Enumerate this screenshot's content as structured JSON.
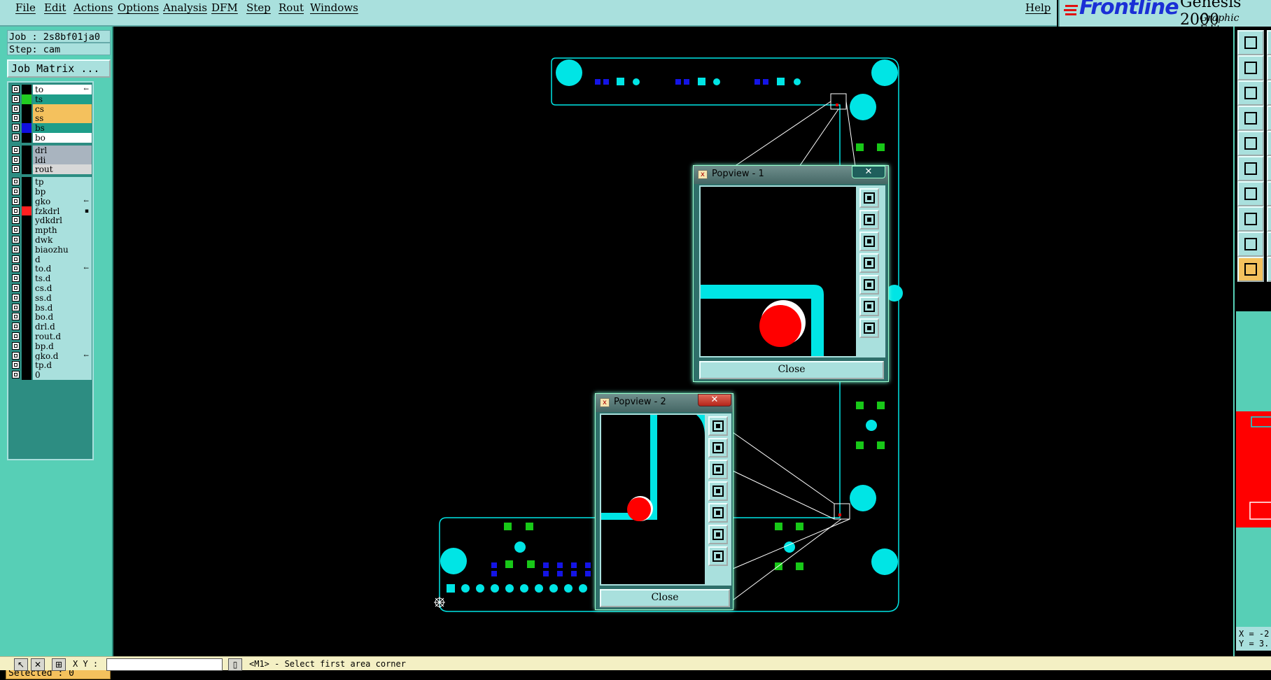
{
  "menu": {
    "items": [
      "File",
      "Edit",
      "Actions",
      "Options",
      "Analysis",
      "DFM",
      "Step",
      "Rout",
      "Windows"
    ],
    "help": "Help"
  },
  "brand": {
    "logo": "Frontline",
    "product": "Genesis 2000",
    "subtitle": "Graphic Editor"
  },
  "job": {
    "job_line": "Job : 2s8bf01ja0",
    "step_line": "Step: cam",
    "matrix_button": "Job Matrix ..."
  },
  "layers": [
    {
      "name": "to",
      "color": "#ffffff",
      "swatch": "#000000",
      "mark": "←"
    },
    {
      "name": "ts",
      "color": "#1f9e8a",
      "swatch": "#22cc22",
      "mark": ""
    },
    {
      "name": "cs",
      "color": "#f4c15d",
      "swatch": "#000000",
      "mark": ""
    },
    {
      "name": "ss",
      "color": "#f4c15d",
      "swatch": "#000000",
      "mark": ""
    },
    {
      "name": "bs",
      "color": "#1f9e8a",
      "swatch": "#1010e0",
      "mark": ""
    },
    {
      "name": "bo",
      "color": "#ffffff",
      "swatch": "#000000",
      "mark": ""
    },
    {
      "name": "drl",
      "color": "#a9b4bf",
      "swatch": "#000000",
      "mark": ""
    },
    {
      "name": "ldi",
      "color": "#a9b4bf",
      "swatch": "#000000",
      "mark": ""
    },
    {
      "name": "rout",
      "color": "#d8d8d8",
      "swatch": "#000000",
      "mark": ""
    },
    {
      "name": "tp",
      "color": "#a9e0dd",
      "swatch": "#000000",
      "mark": ""
    },
    {
      "name": "bp",
      "color": "#a9e0dd",
      "swatch": "#000000",
      "mark": ""
    },
    {
      "name": "gko",
      "color": "#a9e0dd",
      "swatch": "#000000",
      "mark": "←"
    },
    {
      "name": "fzkdrl",
      "color": "#a9e0dd",
      "swatch": "#ff2020",
      "mark": "▪"
    },
    {
      "name": "ydkdrl",
      "color": "#a9e0dd",
      "swatch": "#000000",
      "mark": ""
    },
    {
      "name": "mpth",
      "color": "#a9e0dd",
      "swatch": "#000000",
      "mark": ""
    },
    {
      "name": "dwk",
      "color": "#a9e0dd",
      "swatch": "#000000",
      "mark": ""
    },
    {
      "name": "biaozhu",
      "color": "#a9e0dd",
      "swatch": "#000000",
      "mark": ""
    },
    {
      "name": "d",
      "color": "#a9e0dd",
      "swatch": "#000000",
      "mark": ""
    },
    {
      "name": "to.d",
      "color": "#a9e0dd",
      "swatch": "#000000",
      "mark": "←"
    },
    {
      "name": "ts.d",
      "color": "#a9e0dd",
      "swatch": "#000000",
      "mark": ""
    },
    {
      "name": "cs.d",
      "color": "#a9e0dd",
      "swatch": "#000000",
      "mark": ""
    },
    {
      "name": "ss.d",
      "color": "#a9e0dd",
      "swatch": "#000000",
      "mark": ""
    },
    {
      "name": "bs.d",
      "color": "#a9e0dd",
      "swatch": "#000000",
      "mark": ""
    },
    {
      "name": "bo.d",
      "color": "#a9e0dd",
      "swatch": "#000000",
      "mark": ""
    },
    {
      "name": "drl.d",
      "color": "#a9e0dd",
      "swatch": "#000000",
      "mark": ""
    },
    {
      "name": "rout.d",
      "color": "#a9e0dd",
      "swatch": "#000000",
      "mark": ""
    },
    {
      "name": "bp.d",
      "color": "#a9e0dd",
      "swatch": "#000000",
      "mark": ""
    },
    {
      "name": "gko.d",
      "color": "#a9e0dd",
      "swatch": "#000000",
      "mark": "←"
    },
    {
      "name": "tp.d",
      "color": "#a9e0dd",
      "swatch": "#000000",
      "mark": ""
    },
    {
      "name": "0",
      "color": "#a9e0dd",
      "swatch": "#000000",
      "mark": ""
    }
  ],
  "status": {
    "selected": "Selected : 0",
    "xy_label": "X Y :",
    "prompt": "<M1> - Select first area corner",
    "coord_x": "X = -2",
    "coord_y": "Y = 3."
  },
  "popview1": {
    "title": "Popview - 1",
    "close": "Close",
    "x": "✕"
  },
  "popview2": {
    "title": "Popview - 2",
    "close": "Close",
    "x": "✕"
  },
  "colors": {
    "outline": "#00e5e5",
    "pad_cyan": "#00e5e5",
    "pad_green": "#18c818",
    "pad_blue": "#1414e6",
    "highlight_red": "#ff0000",
    "panel_teal": "#57cfb6",
    "menu_bg": "#a9e0dd"
  }
}
